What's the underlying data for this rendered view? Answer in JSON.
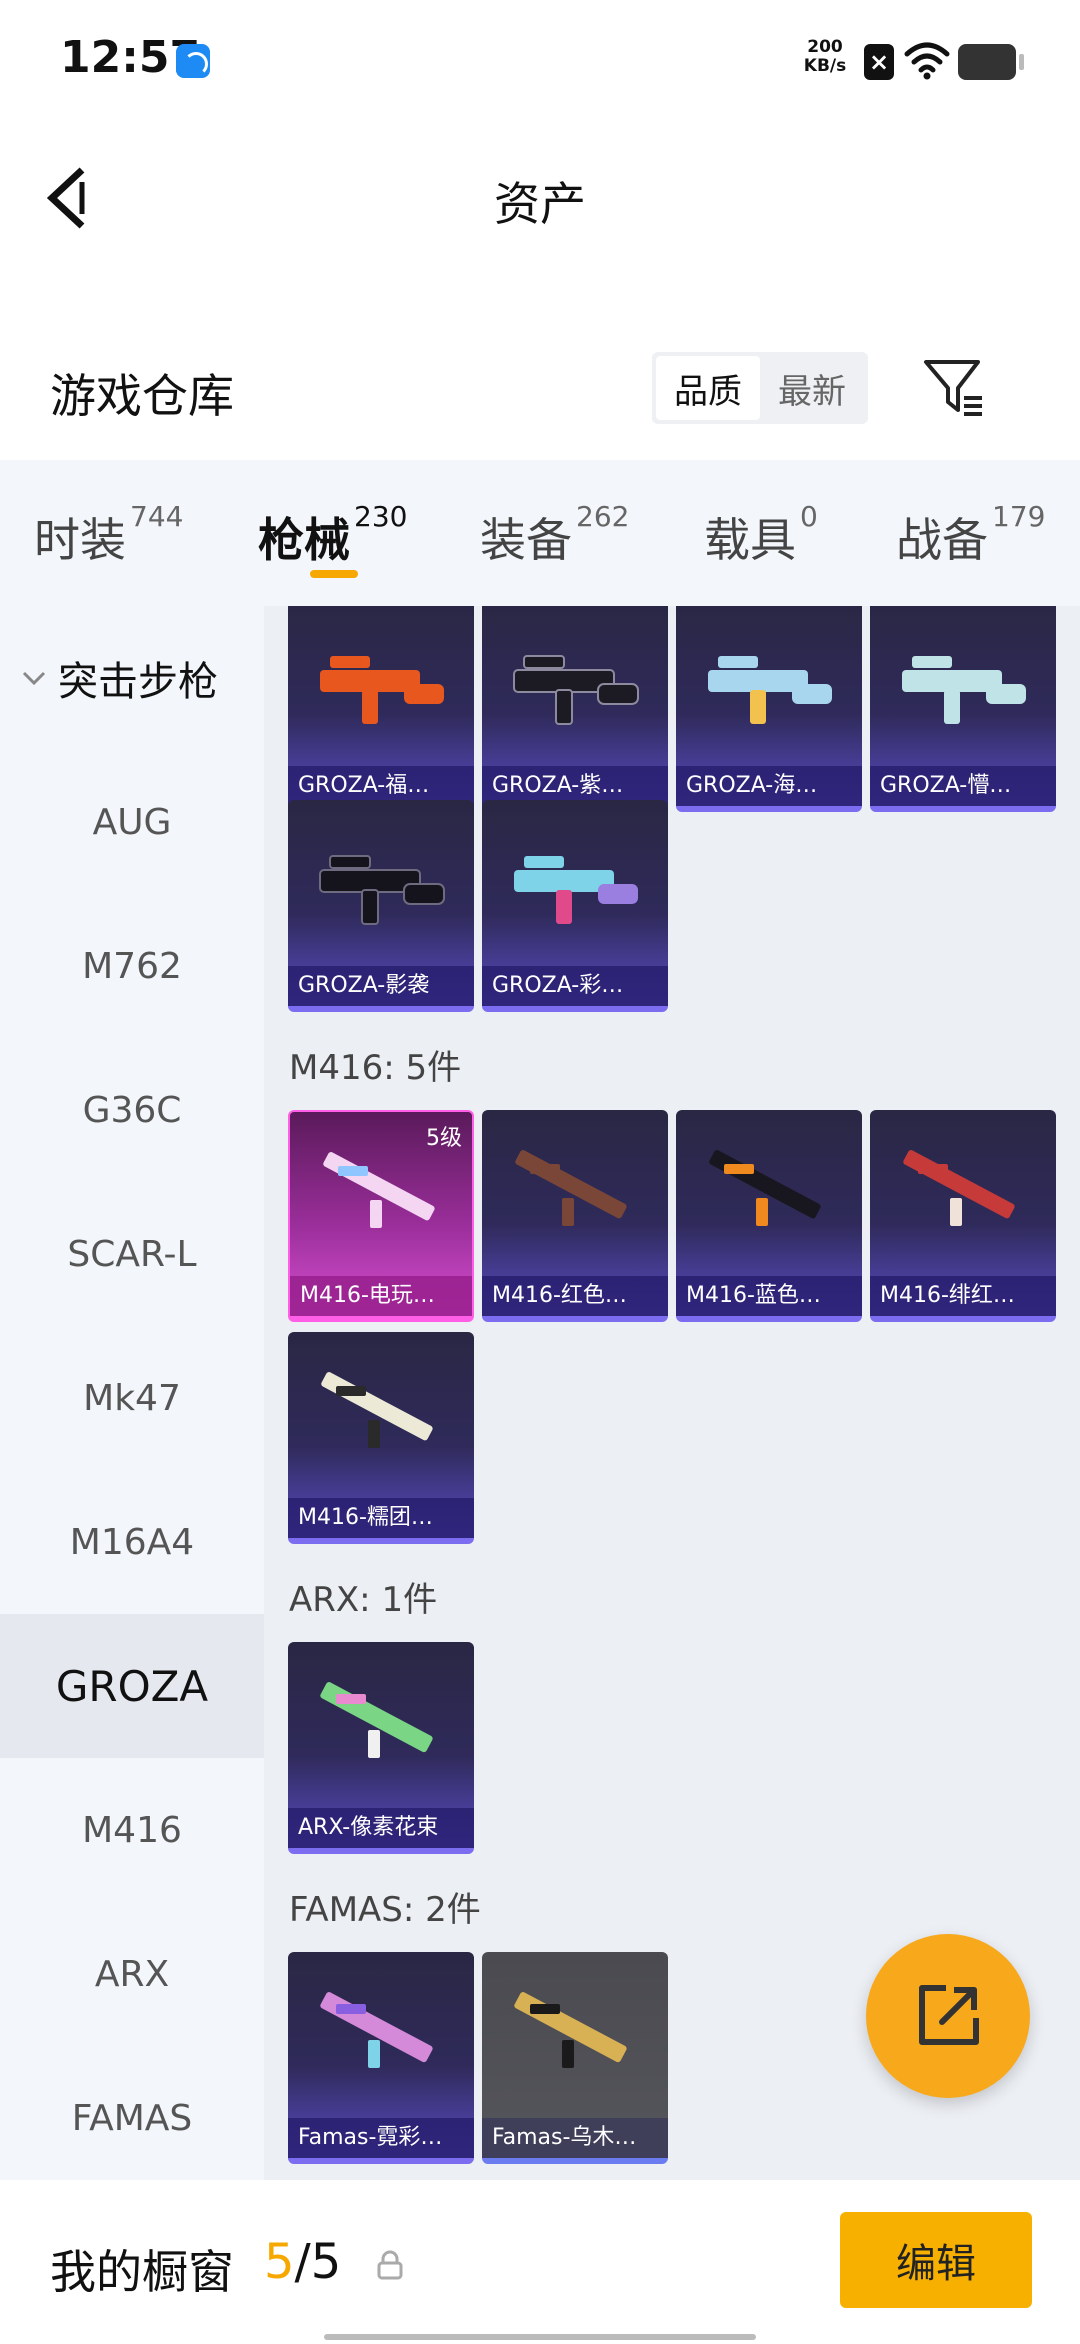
{
  "status_bar": {
    "time": "12:57",
    "net_speed_value": "200",
    "net_speed_unit": "KB/s"
  },
  "header": {
    "title": "资产"
  },
  "warehouse": {
    "title": "游戏仓库",
    "sort_options": [
      "品质",
      "最新"
    ],
    "active_sort": "品质"
  },
  "tabs": [
    {
      "label": "时装",
      "count": "744"
    },
    {
      "label": "枪械",
      "count": "230"
    },
    {
      "label": "装备",
      "count": "262"
    },
    {
      "label": "载具",
      "count": "0"
    },
    {
      "label": "战备",
      "count": "179"
    }
  ],
  "active_tab": "枪械",
  "sidebar": {
    "group": "突击步枪",
    "items": [
      "AUG",
      "M762",
      "G36C",
      "SCAR-L",
      "Mk47",
      "M16A4",
      "GROZA",
      "M416",
      "ARX",
      "FAMAS"
    ],
    "active": "GROZA"
  },
  "sections": [
    {
      "label": "",
      "items": [
        {
          "name": "GROZA-福…",
          "theme": "orange"
        },
        {
          "name": "GROZA-紫…",
          "theme": "dark"
        },
        {
          "name": "GROZA-海…",
          "theme": "sky"
        },
        {
          "name": "GROZA-懵…",
          "theme": "mint"
        },
        {
          "name": "GROZA-影袭",
          "theme": "dark"
        },
        {
          "name": "GROZA-彩…",
          "theme": "rainbow"
        }
      ]
    },
    {
      "label": "M416: 5件",
      "items": [
        {
          "name": "M416-电玩…",
          "theme": "pinkwhite",
          "level": "5级",
          "rarity": "pink"
        },
        {
          "name": "M416-红色…",
          "theme": "brown"
        },
        {
          "name": "M416-蓝色…",
          "theme": "orangeblack"
        },
        {
          "name": "M416-绯红…",
          "theme": "red"
        },
        {
          "name": "M416-糯团…",
          "theme": "cream"
        }
      ]
    },
    {
      "label": "ARX: 1件",
      "items": [
        {
          "name": "ARX-像素花束",
          "theme": "green"
        }
      ]
    },
    {
      "label": "FAMAS: 2件",
      "items": [
        {
          "name": "Famas-霓彩…",
          "theme": "purple"
        },
        {
          "name": "Famas-乌木…",
          "theme": "gold",
          "rarity": "gray"
        }
      ]
    }
  ],
  "bottom": {
    "title": "我的橱窗",
    "count_current": "5",
    "count_sep": "/",
    "count_total": "5",
    "edit_label": "编辑"
  },
  "icons": [
    "back-arrow-icon",
    "filter-icon",
    "chevron-down-icon",
    "share-icon",
    "lock-icon",
    "wifi-icon",
    "battery-icon"
  ],
  "colors": {
    "accent": "#f6a800",
    "card_purple": "#5a4cc4",
    "card_pink": "#d64fd0"
  }
}
